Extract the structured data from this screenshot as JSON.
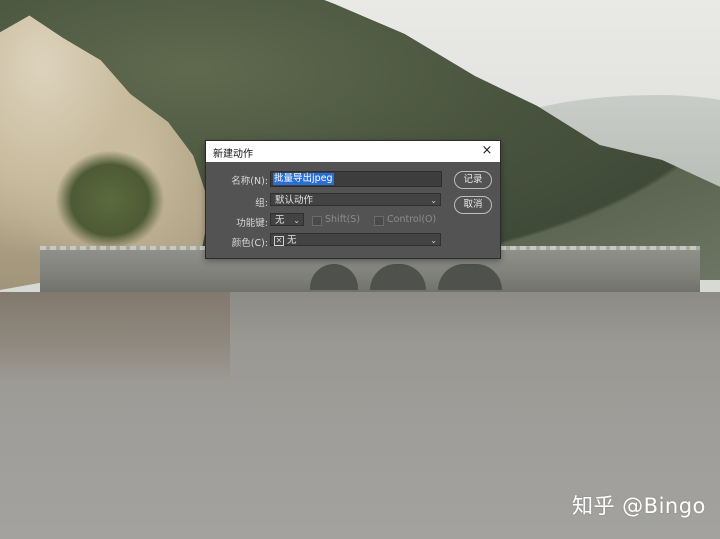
{
  "dialog": {
    "title": "新建动作",
    "close_glyph": "×",
    "fields": {
      "name_label": "名称(N):",
      "name_value": "批量导出jpeg",
      "group_label": "组:",
      "group_value": "默认动作",
      "fkey_label": "功能键:",
      "fkey_value": "无",
      "shift_label": "Shift(S)",
      "control_label": "Control(O)",
      "color_label": "颜色(C):",
      "color_value": "无",
      "color_swatch_glyph": "✕"
    },
    "buttons": {
      "record_label": "记录",
      "cancel_label": "取消"
    },
    "selection_color": "#2a6fd6"
  },
  "watermark": {
    "text": "知乎 @Bingo"
  }
}
